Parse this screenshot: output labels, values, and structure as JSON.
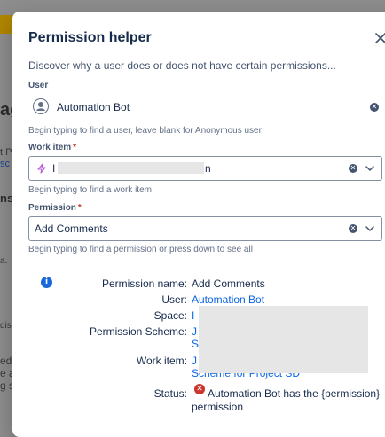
{
  "background": {
    "fragment_big": "ag",
    "fragment_small1": "t P",
    "fragment_link": "sc",
    "fragment_heading": "ns",
    "fragment_a": "a.",
    "fragment_dis": "dis",
    "fragment_lines": [
      "ed t",
      "e al",
      "g s"
    ]
  },
  "modal": {
    "title": "Permission helper",
    "description": "Discover why a user does or does not have certain permissions...",
    "close_icon": "close-icon"
  },
  "user_field": {
    "label": "User",
    "value": "Automation Bot",
    "helper": "Begin typing to find a user, leave blank for Anonymous user"
  },
  "work_item_field": {
    "label": "Work item",
    "required_mark": "*",
    "value_start": "I",
    "value_end": "n",
    "helper": "Begin typing to find a work item"
  },
  "permission_field": {
    "label": "Permission",
    "required_mark": "*",
    "value": "Add Comments",
    "helper": "Begin typing to find a permission or press down to see all"
  },
  "results": {
    "permission_name_label": "Permission name:",
    "permission_name_value": "Add Comments",
    "user_label": "User:",
    "user_value": "Automation Bot",
    "space_label": "Space:",
    "space_value_partial": "I",
    "scheme_label": "Permission Scheme:",
    "scheme_value_partial_1": "J",
    "scheme_value_partial_2": "S",
    "work_item_label": "Work item:",
    "work_item_value_partial": "J",
    "work_item_value_tail": "Scheme for Project SD",
    "status_label": "Status:",
    "status_value_line1": "Automation Bot has the {permission}",
    "status_value_line2": "permission"
  },
  "colors": {
    "link": "#0c66e4",
    "error": "#c9372c",
    "info": "#1868db"
  }
}
